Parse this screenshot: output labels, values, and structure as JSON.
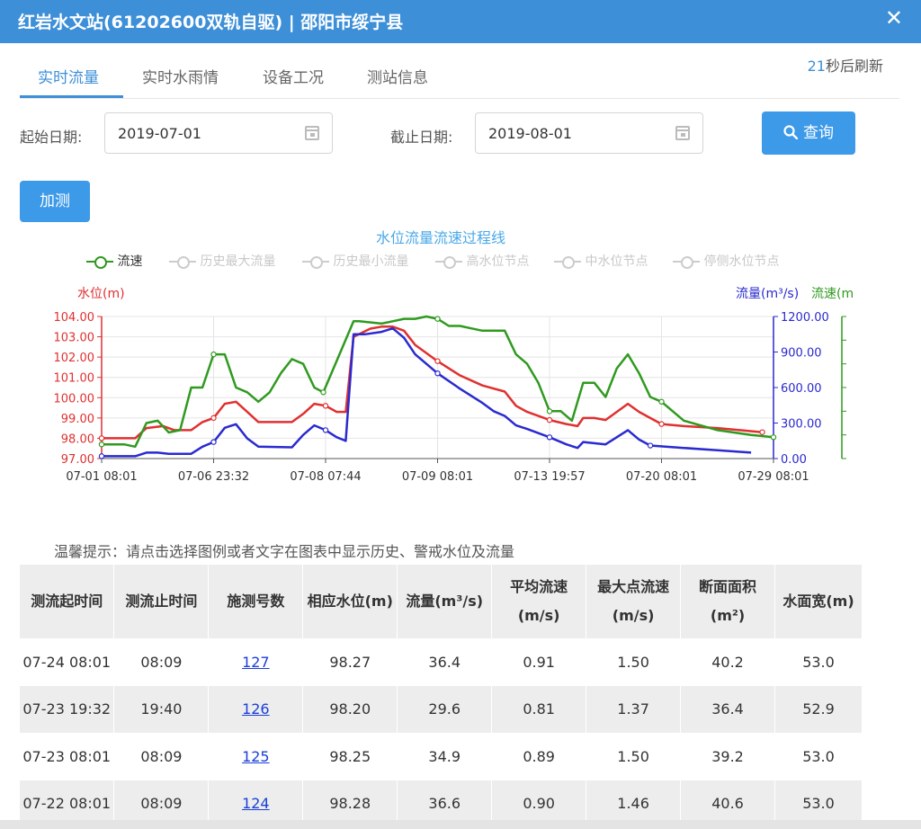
{
  "window": {
    "title": "红岩水文站(61202600双轨自驱) | 邵阳市绥宁县",
    "close_symbol": "✕"
  },
  "tabs": [
    {
      "label": "实时流量",
      "active": true
    },
    {
      "label": "实时水雨情"
    },
    {
      "label": "设备工况"
    },
    {
      "label": "测站信息"
    }
  ],
  "refresh": {
    "count": "21",
    "suffix": "秒后刷新"
  },
  "filters": {
    "start_label": "起始日期:",
    "start_value": "2019-07-01",
    "end_label": "截止日期:",
    "end_value": "2019-08-01",
    "query_label": "查询",
    "add_label": "加测"
  },
  "colors": {
    "accent": "#3d8fd8",
    "level": "#e03030",
    "flow": "#2a2ad0",
    "speed": "#2f9a1f"
  },
  "chart": {
    "title": "水位流量流速过程线",
    "legend": [
      "流速",
      "历史最大流量",
      "历史最小流量",
      "高水位节点",
      "中水位节点",
      "停侧水位节点"
    ],
    "left_axis_name": "水位(m)",
    "right_axis_name": "流量(m³/s)",
    "right_axis2_name": "流速(m",
    "hint": "温馨提示：请点击选择图例或者文字在图表中显示历史、警戒水位及流量"
  },
  "chart_data": {
    "type": "line",
    "x_ticks": [
      "07-01 08:01",
      "07-06 23:32",
      "07-08 07:44",
      "07-09 08:01",
      "07-13 19:57",
      "07-20 08:01",
      "07-29 08:01"
    ],
    "y_left": {
      "name": "水位(m)",
      "range": [
        97,
        104
      ],
      "ticks": [
        "97.00",
        "98.00",
        "99.00",
        "100.00",
        "101.00",
        "102.00",
        "103.00",
        "104.00"
      ]
    },
    "y_right": {
      "name": "流量(m³/s)",
      "range": [
        0,
        1200
      ],
      "ticks": [
        "0.00",
        "300.00",
        "600.00",
        "900.00",
        "1200.00"
      ]
    },
    "x_index_range": [
      0,
      60
    ],
    "series": [
      {
        "name": "水位",
        "axis": "left",
        "values": [
          [
            0,
            98.0
          ],
          [
            1.5,
            98.0
          ],
          [
            3,
            98.0
          ],
          [
            4,
            98.5
          ],
          [
            5.5,
            98.6
          ],
          [
            6.5,
            98.4
          ],
          [
            8,
            98.4
          ],
          [
            9,
            98.8
          ],
          [
            10,
            99.0
          ],
          [
            11,
            99.7
          ],
          [
            12,
            99.8
          ],
          [
            13,
            99.3
          ],
          [
            14,
            98.8
          ],
          [
            15,
            98.8
          ],
          [
            16,
            98.8
          ],
          [
            17,
            98.8
          ],
          [
            18,
            99.2
          ],
          [
            19,
            99.7
          ],
          [
            20,
            99.6
          ],
          [
            21,
            99.3
          ],
          [
            21.8,
            99.3
          ],
          [
            22.5,
            103.0
          ],
          [
            24,
            103.4
          ],
          [
            25,
            103.5
          ],
          [
            26,
            103.5
          ],
          [
            27,
            103.3
          ],
          [
            28,
            102.6
          ],
          [
            30,
            101.8
          ],
          [
            32,
            101.1
          ],
          [
            34,
            100.6
          ],
          [
            36,
            100.3
          ],
          [
            37,
            99.6
          ],
          [
            38,
            99.3
          ],
          [
            40,
            98.9
          ],
          [
            41.5,
            98.7
          ],
          [
            42.5,
            98.6
          ],
          [
            43,
            99.0
          ],
          [
            44,
            99.0
          ],
          [
            45,
            98.9
          ],
          [
            46,
            99.3
          ],
          [
            47,
            99.7
          ],
          [
            48,
            99.3
          ],
          [
            49,
            99.0
          ],
          [
            50,
            98.7
          ],
          [
            52,
            98.6
          ],
          [
            55,
            98.5
          ],
          [
            57,
            98.4
          ],
          [
            59,
            98.3
          ],
          [
            61,
            98.2
          ],
          [
            63,
            98.1
          ]
        ]
      },
      {
        "name": "流量",
        "axis": "right",
        "values": [
          [
            0,
            20
          ],
          [
            2,
            20
          ],
          [
            3,
            20
          ],
          [
            4,
            50
          ],
          [
            5,
            50
          ],
          [
            6,
            40
          ],
          [
            8,
            40
          ],
          [
            9,
            100
          ],
          [
            10,
            140
          ],
          [
            11,
            260
          ],
          [
            12,
            290
          ],
          [
            13,
            170
          ],
          [
            14,
            100
          ],
          [
            17,
            95
          ],
          [
            18,
            200
          ],
          [
            19,
            280
          ],
          [
            20,
            240
          ],
          [
            21,
            180
          ],
          [
            21.8,
            150
          ],
          [
            22.5,
            1050
          ],
          [
            23.5,
            1050
          ],
          [
            25,
            1070
          ],
          [
            26,
            1100
          ],
          [
            27,
            1020
          ],
          [
            28,
            880
          ],
          [
            30,
            720
          ],
          [
            32,
            590
          ],
          [
            34,
            470
          ],
          [
            35,
            400
          ],
          [
            36,
            360
          ],
          [
            37,
            280
          ],
          [
            38,
            250
          ],
          [
            40,
            180
          ],
          [
            41.5,
            120
          ],
          [
            42.5,
            90
          ],
          [
            43,
            140
          ],
          [
            45,
            120
          ],
          [
            46,
            180
          ],
          [
            47,
            240
          ],
          [
            48,
            160
          ],
          [
            49,
            110
          ],
          [
            52,
            90
          ],
          [
            55,
            70
          ],
          [
            58,
            50
          ],
          [
            61,
            30
          ],
          [
            63,
            20
          ]
        ]
      },
      {
        "name": "流速",
        "axis": "right2",
        "values": [
          [
            0,
            0.3
          ],
          [
            1,
            0.3
          ],
          [
            2,
            0.3
          ],
          [
            3,
            0.25
          ],
          [
            4,
            0.75
          ],
          [
            5,
            0.8
          ],
          [
            6,
            0.55
          ],
          [
            7,
            0.6
          ],
          [
            8,
            1.5
          ],
          [
            9,
            1.5
          ],
          [
            10,
            2.2
          ],
          [
            11,
            2.2
          ],
          [
            12,
            1.5
          ],
          [
            13,
            1.4
          ],
          [
            14,
            1.2
          ],
          [
            15,
            1.4
          ],
          [
            16,
            1.8
          ],
          [
            17,
            2.1
          ],
          [
            18,
            2.0
          ],
          [
            19,
            1.5
          ],
          [
            19.8,
            1.4
          ],
          [
            22.5,
            2.9
          ],
          [
            23,
            2.9
          ],
          [
            25,
            2.85
          ],
          [
            26,
            2.9
          ],
          [
            27,
            2.95
          ],
          [
            28,
            2.95
          ],
          [
            29,
            3.0
          ],
          [
            30,
            2.95
          ],
          [
            31,
            2.8
          ],
          [
            32,
            2.8
          ],
          [
            33,
            2.75
          ],
          [
            34,
            2.7
          ],
          [
            35,
            2.7
          ],
          [
            36,
            2.7
          ],
          [
            37,
            2.2
          ],
          [
            38,
            2.0
          ],
          [
            39,
            1.6
          ],
          [
            40,
            1.0
          ],
          [
            40.5,
            1.0
          ],
          [
            41,
            1.0
          ],
          [
            42,
            0.8
          ],
          [
            43,
            1.6
          ],
          [
            44,
            1.6
          ],
          [
            45,
            1.3
          ],
          [
            46,
            1.9
          ],
          [
            47,
            2.2
          ],
          [
            48,
            1.8
          ],
          [
            49,
            1.3
          ],
          [
            50,
            1.2
          ],
          [
            52,
            0.8
          ],
          [
            55,
            0.6
          ],
          [
            58,
            0.5
          ],
          [
            60,
            0.45
          ],
          [
            61,
            0.5
          ],
          [
            62,
            0.4
          ],
          [
            63,
            0.35
          ],
          [
            64,
            0.3
          ]
        ]
      }
    ]
  },
  "table": {
    "headers": [
      "测流起时间",
      "测流止时间",
      "施测号数",
      "相应水位(m)",
      "流量(m³/s)",
      "平均流速(m/s)",
      "最大点流速(m/s)",
      "断面面积(m²)",
      "水面宽(m)"
    ],
    "rows": [
      [
        "07-24 08:01",
        "08:09",
        "127",
        "98.27",
        "36.4",
        "0.91",
        "1.50",
        "40.2",
        "53.0"
      ],
      [
        "07-23 19:32",
        "19:40",
        "126",
        "98.20",
        "29.6",
        "0.81",
        "1.37",
        "36.4",
        "52.9"
      ],
      [
        "07-23 08:01",
        "08:09",
        "125",
        "98.25",
        "34.9",
        "0.89",
        "1.50",
        "39.2",
        "53.0"
      ],
      [
        "07-22 08:01",
        "08:09",
        "124",
        "98.28",
        "36.6",
        "0.90",
        "1.46",
        "40.6",
        "53.0"
      ]
    ]
  }
}
